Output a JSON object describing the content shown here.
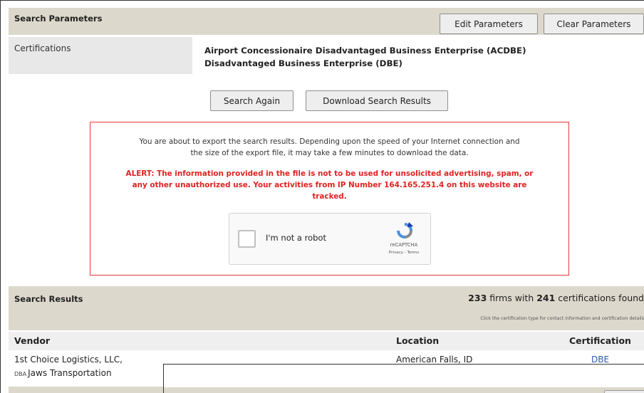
{
  "search_parameters": {
    "title": "Search Parameters",
    "edit_label": "Edit Parameters",
    "clear_label": "Clear Parameters",
    "certifications_label": "Certifications",
    "certifications": [
      "Airport Concessionaire Disadvantaged Business Enterprise (ACDBE)",
      "Disadvantaged Business Enterprise (DBE)"
    ]
  },
  "actions": {
    "search_again_label": "Search Again",
    "download_label": "Download Search Results"
  },
  "export_notice": {
    "info_line1": "You are about to export the search results. Depending upon the speed of your Internet connection and",
    "info_line2": "the size of the export file, it may take a few minutes to download the data.",
    "alert_line1": "ALERT: The information provided in the file is not to be used for unsolicited advertising, spam, or",
    "alert_line2": "any other unauthorized use. Your activities from IP Number 164.165.251.4 on this website are",
    "alert_line3": "tracked."
  },
  "captcha": {
    "label": "I'm not a robot",
    "brand": "reCAPTCHA",
    "links": "Privacy - Terms",
    "checked": false
  },
  "search_results": {
    "title": "Search Results",
    "firm_count": "233",
    "firms_text": " firms with ",
    "cert_count": "241",
    "certs_text": " certifications found",
    "hint": "Click the certification type for contact information and certification details",
    "columns": {
      "vendor": "Vendor",
      "location": "Location",
      "certification": "Certification"
    },
    "rows": [
      {
        "vendor": "1st Choice Logistics, LLC,",
        "dba_tag": "DBA",
        "dba_name": "Jaws Transportation",
        "location": "American Falls, ID",
        "certification": "DBE"
      }
    ]
  },
  "colors": {
    "header_band": "#dcd8cb",
    "alert_red": "#e02222",
    "link_blue": "#2a5db0"
  }
}
